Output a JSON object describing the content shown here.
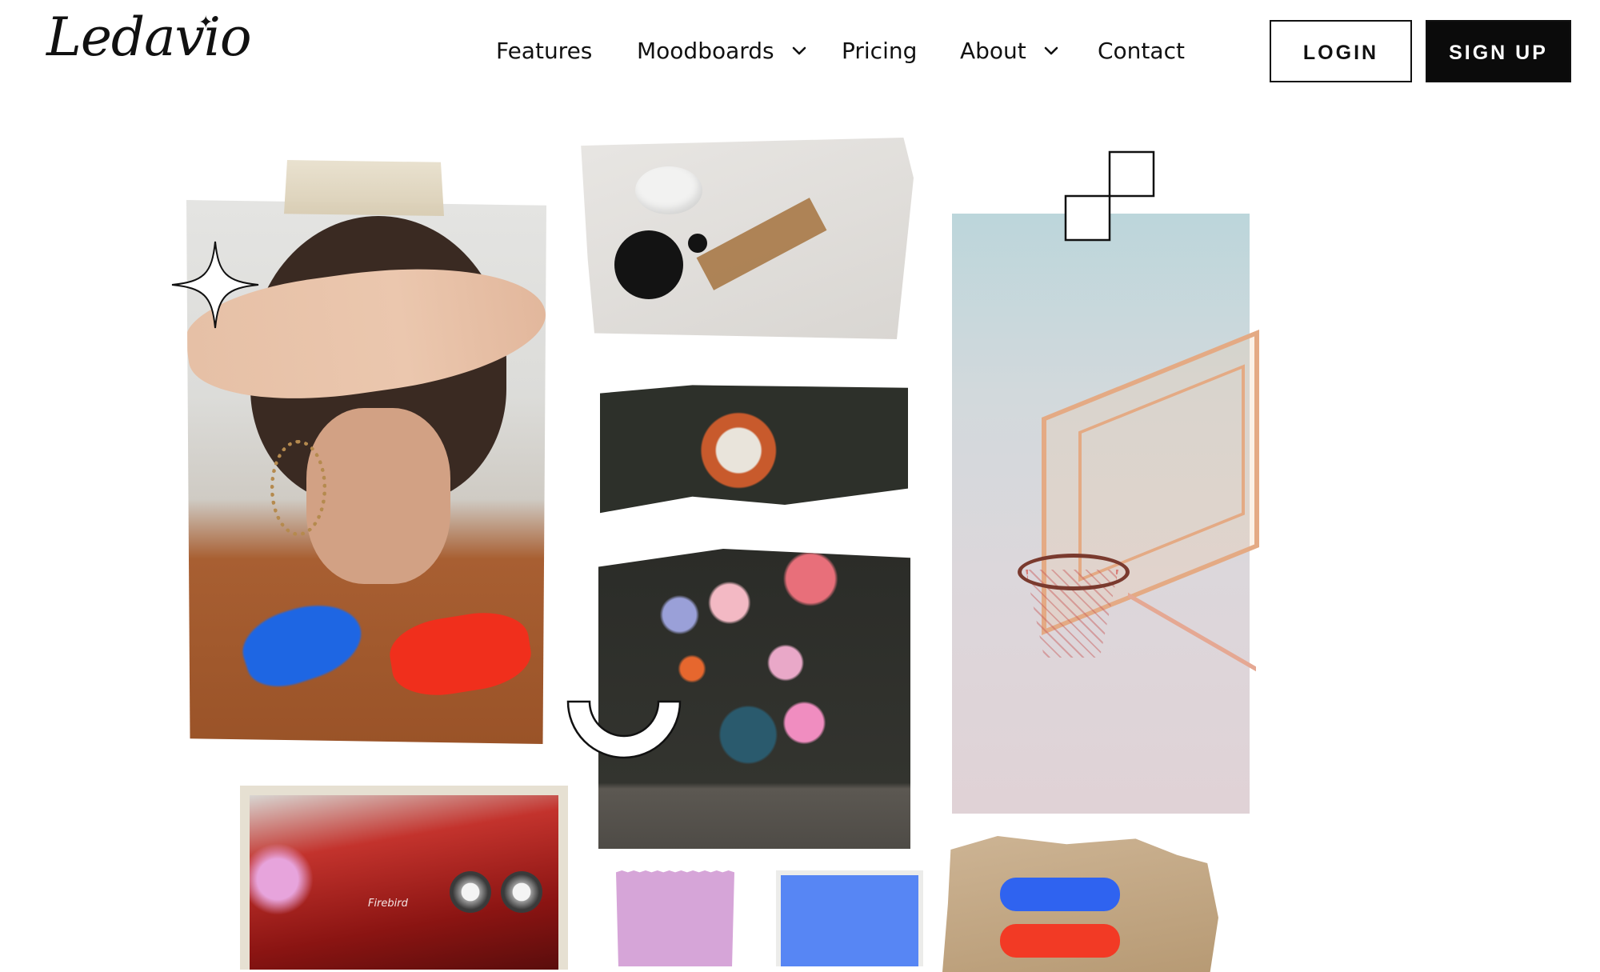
{
  "brand": {
    "logo_text": "Ledavio",
    "logo_star": "✦"
  },
  "nav": {
    "items": [
      {
        "label": "Features",
        "has_dropdown": false
      },
      {
        "label": "Moodboards",
        "has_dropdown": true
      },
      {
        "label": "Pricing",
        "has_dropdown": false
      },
      {
        "label": "About",
        "has_dropdown": true
      },
      {
        "label": "Contact",
        "has_dropdown": false
      }
    ],
    "login_label": "LOGIN",
    "signup_label": "SIGN UP"
  },
  "moodboard": {
    "car_badge_text": "Firebird"
  },
  "colors": {
    "text": "#111111",
    "signup_bg": "#0b0b0b",
    "signup_text": "#ffffff",
    "background": "#ffffff",
    "accent_blue": "#2f63f0",
    "accent_red": "#f23a25",
    "swatch_pink": "#d6a5d8",
    "swatch_blue": "#5786f4"
  },
  "icons": {
    "chevron": "chevron-down-icon",
    "sparkle": "sparkle-icon",
    "squares": "stacked-squares-icon",
    "arc": "half-circle-arc-icon"
  }
}
